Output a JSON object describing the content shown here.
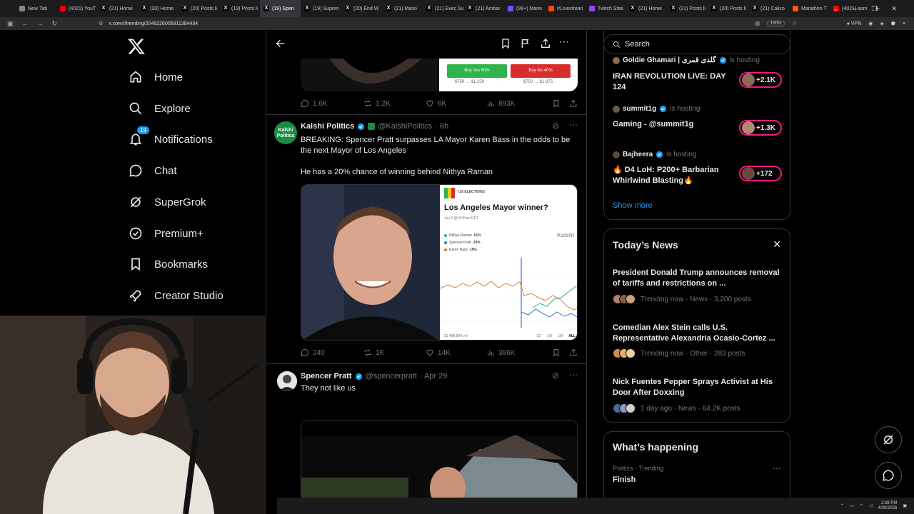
{
  "browser": {
    "tabs": [
      {
        "label": "New Tab",
        "color": "#888888",
        "glyph": ""
      },
      {
        "label": "(4021) YouT",
        "color": "#ff0000",
        "glyph": ""
      },
      {
        "label": "(21) Home",
        "color": "#000000",
        "glyph": "X"
      },
      {
        "label": "(20) Home",
        "color": "#000000",
        "glyph": "X"
      },
      {
        "label": "(20) Posts li",
        "color": "#000000",
        "glyph": "X"
      },
      {
        "label": "(19) Posts li",
        "color": "#000000",
        "glyph": "X"
      },
      {
        "label": "(19) Spen",
        "color": "#000000",
        "glyph": "X"
      },
      {
        "label": "(19) Supren",
        "color": "#000000",
        "glyph": "X"
      },
      {
        "label": "(20) End W",
        "color": "#000000",
        "glyph": "X"
      },
      {
        "label": "(21) Mario",
        "color": "#000000",
        "glyph": "X"
      },
      {
        "label": "(21) Exec Su",
        "color": "#000000",
        "glyph": "X"
      },
      {
        "label": "(21) Ambar",
        "color": "#000000",
        "glyph": "X"
      },
      {
        "label": "(99+) Mario",
        "color": "#7b4fff",
        "glyph": ""
      },
      {
        "label": "r/Livestrean",
        "color": "#ff4500",
        "glyph": ""
      },
      {
        "label": "Twitch Stati",
        "color": "#9146ff",
        "glyph": ""
      },
      {
        "label": "(21) Home",
        "color": "#000000",
        "glyph": "X"
      },
      {
        "label": "(21) Posts li",
        "color": "#000000",
        "glyph": "X"
      },
      {
        "label": "(20) Posts li",
        "color": "#000000",
        "glyph": "X"
      },
      {
        "label": "(21) Calico",
        "color": "#000000",
        "glyph": "X"
      },
      {
        "label": "Marathon T",
        "color": "#ff5a00",
        "glyph": ""
      },
      {
        "label": "(4021) asm",
        "color": "#ff0000",
        "glyph": ""
      }
    ],
    "active_tab_index": 6,
    "new_tab": "+",
    "url": "x.com/i/trending/2049226005911384434",
    "zoom": "150%",
    "vpn": "VPN"
  },
  "nav": {
    "items": [
      {
        "label": "Home",
        "icon": "home-icon"
      },
      {
        "label": "Explore",
        "icon": "search-icon"
      },
      {
        "label": "Notifications",
        "icon": "bell-icon",
        "badge": "19"
      },
      {
        "label": "Chat",
        "icon": "chat-icon"
      },
      {
        "label": "SuperGrok",
        "icon": "grok-icon"
      },
      {
        "label": "Premium+",
        "icon": "premium-icon"
      },
      {
        "label": "Bookmarks",
        "icon": "bookmark-icon"
      },
      {
        "label": "Creator Studio",
        "icon": "rocket-icon"
      }
    ]
  },
  "feed": {
    "top_post": {
      "buy_yes": "Buy Yes 60%",
      "buy_no": "Buy No 40%",
      "yes_payout": "$750 → $1,250",
      "no_payout": "$750 → $1,875",
      "replies": "1.6K",
      "reposts": "1.2K",
      "likes": "6K",
      "views": "893K"
    },
    "post1": {
      "avatar_text": "Kalshi Politics",
      "name": "Kalshi Politics",
      "handle": "@KalshiPolitics",
      "time": "· 6h",
      "text1": "BREAKING: Spencer Pratt surpasses LA Mayor Karen Bass in the odds to be the next Mayor of Los Angeles",
      "text2": "He has a 20% chance of winning behind Nithya Raman",
      "card": {
        "tag": "US ELECTIONS",
        "title": "Los Angeles Mayor winner?",
        "date": "Jun 2 @ 8:00am EDT",
        "brand": "Kalshi",
        "legend": [
          {
            "name": "Nithya Raman",
            "value": "61%",
            "color": "#2bb673"
          },
          {
            "name": "Spencer Pratt",
            "value": "20%",
            "color": "#3b6fd8"
          },
          {
            "name": "Karen Bass",
            "value": "18%",
            "color": "#e07a2e"
          }
        ],
        "volume": "$1,488,894 vol",
        "ranges": [
          "1D",
          "1W",
          "1M",
          "ALL"
        ]
      },
      "replies": "240",
      "reposts": "1K",
      "likes": "14K",
      "views": "386K"
    },
    "post2": {
      "name": "Spencer Pratt",
      "handle": "@spencerpratt",
      "time": "· Apr 29",
      "text": "They not like us"
    }
  },
  "right": {
    "search_placeholder": "Search",
    "spaces": [
      {
        "host": "Goldie Ghamari | گلدی قمری",
        "tag": "is hosting",
        "title": "IRAN REVOLUTION LIVE: DAY 124",
        "count": "+2.1K"
      },
      {
        "host": "summit1g",
        "tag": "is hosting",
        "title": "Gaming - @summit1g",
        "count": "+1.3K"
      },
      {
        "host": "Bajheera",
        "tag": "is hosting",
        "title": "🔥 D4 LoH: P200+ Barbarian Whirlwind Blasting🔥",
        "count": "+172"
      }
    ],
    "show_more": "Show more",
    "news_heading": "Today’s News",
    "news": [
      {
        "title": "President Donald Trump announces removal of tariffs and restrictions on ...",
        "meta": "Trending now · News · 3,200 posts"
      },
      {
        "title": "Comedian Alex Stein calls U.S. Representative Alexandria Ocasio-Cortez ...",
        "meta": "Trending now · Other · 283 posts"
      },
      {
        "title": "Nick Fuentes Pepper Sprays Activist at His Door After Doxxing",
        "meta": "1 day ago · News · 64.2K posts"
      }
    ],
    "happening_heading": "What’s happening",
    "happening": [
      {
        "meta": "Politics · Trending",
        "title": "Finish"
      }
    ]
  },
  "taskbar": {
    "time": "2:38 PM",
    "date": "4/30/2026"
  },
  "colors": {
    "accent": "#1d9bf0",
    "space_ring": "#f91880",
    "buy_yes": "#2fb34a",
    "buy_no": "#d92d2d"
  }
}
